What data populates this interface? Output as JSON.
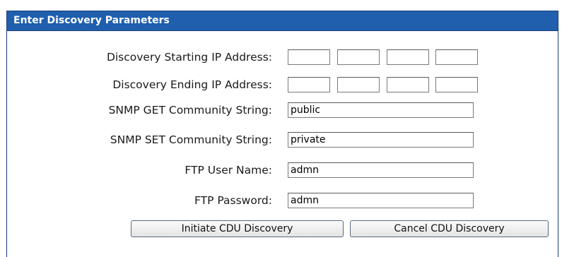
{
  "panel": {
    "title": "Enter Discovery Parameters"
  },
  "form": {
    "start_ip": {
      "label": "Discovery Starting IP Address:",
      "octets": [
        "",
        "",
        "",
        ""
      ]
    },
    "end_ip": {
      "label": "Discovery Ending IP Address:",
      "octets": [
        "",
        "",
        "",
        ""
      ]
    },
    "snmp_get": {
      "label": "SNMP GET Community String:",
      "value": "public"
    },
    "snmp_set": {
      "label": "SNMP SET Community String:",
      "value": "private"
    },
    "ftp_user": {
      "label": "FTP User Name:",
      "value": "admn"
    },
    "ftp_password": {
      "label": "FTP Password:",
      "value": "admn"
    }
  },
  "buttons": {
    "initiate_label": "Initiate CDU Discovery",
    "cancel_label": "Cancel CDU Discovery"
  }
}
